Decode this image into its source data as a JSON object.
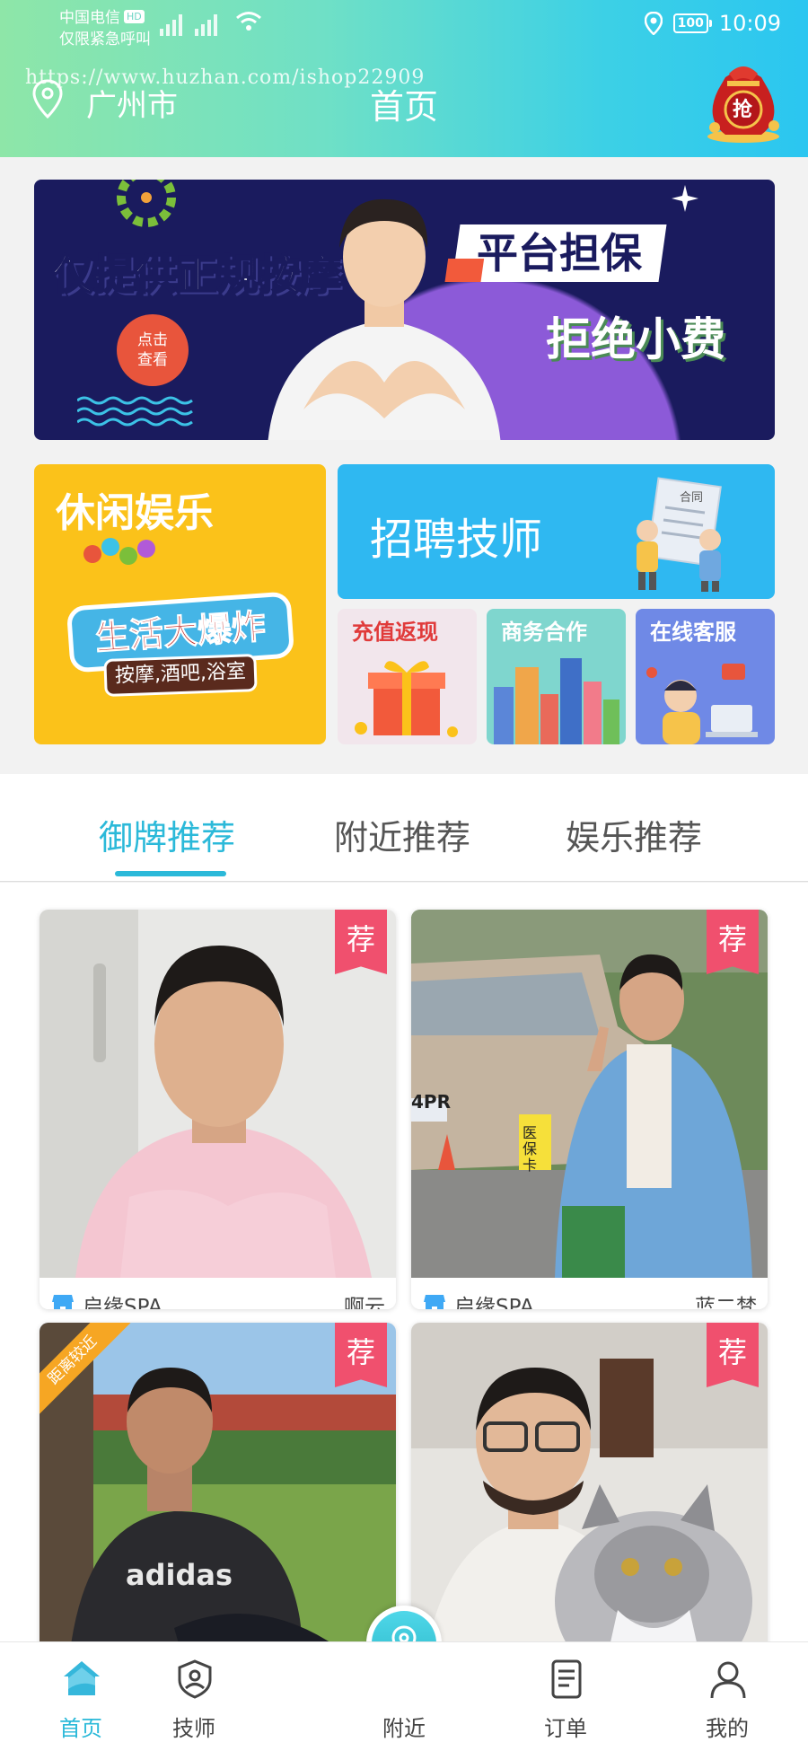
{
  "status_bar": {
    "carrier": "中国电信",
    "carrier_badge": "HD",
    "emergency": "仅限紧急呼叫",
    "battery": "100",
    "time": "10:09"
  },
  "watermark": "https://www.huzhan.com/ishop22909",
  "header": {
    "city": "广州市",
    "title": "首页",
    "grab_label": "抢"
  },
  "banner": {
    "line1": "仅提供正规按摩",
    "badge": "平台担保",
    "line2": "拒绝小费",
    "click_line1": "点击",
    "click_line2": "查看"
  },
  "features": {
    "fun_title": "休闲娱乐",
    "fun_sign": "生活大爆炸",
    "fun_sub": "按摩,酒吧,浴室",
    "hire_title": "招聘技师",
    "hire_doc": "合同",
    "recharge": "充值返现",
    "business": "商务合作",
    "service": "在线客服"
  },
  "tabs": [
    {
      "label": "御牌推荐",
      "active": true
    },
    {
      "label": "附近推荐",
      "active": false
    },
    {
      "label": "娱乐推荐",
      "active": false
    }
  ],
  "cards": [
    {
      "badge": "荐",
      "shop": "启缘SPA",
      "name": "啊云"
    },
    {
      "badge": "荐",
      "shop": "启缘SPA",
      "name": "蓝二梵",
      "photo_text": "4PR",
      "sign_text": "医保卡"
    },
    {
      "badge": "荐",
      "ribbon": "距离较近",
      "shirt_text": "adidas"
    },
    {
      "badge": "荐"
    }
  ],
  "tabbar": [
    {
      "label": "首页",
      "icon": "home-icon",
      "active": true
    },
    {
      "label": "技师",
      "icon": "technician-shield-icon",
      "active": false
    },
    {
      "label": "附近",
      "icon": "location-pin-icon",
      "active": false
    },
    {
      "label": "订单",
      "icon": "order-list-icon",
      "active": false
    },
    {
      "label": "我的",
      "icon": "user-profile-icon",
      "active": false
    }
  ],
  "colors": {
    "accent": "#2bb9d9",
    "recommend_badge": "#f0506e",
    "header_gradient_start": "#8ee6a8",
    "header_gradient_end": "#2bc6f0"
  }
}
